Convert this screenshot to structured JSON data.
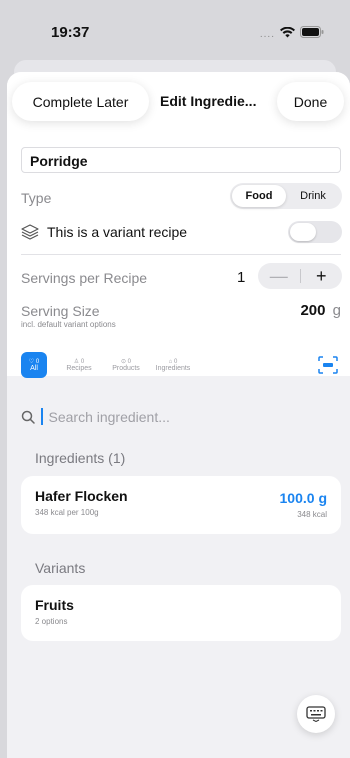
{
  "status_bar": {
    "time": "19:37",
    "dots": "...."
  },
  "nav": {
    "left_button": "Complete Later",
    "title": "Edit Ingredie...",
    "right_button": "Done"
  },
  "recipe": {
    "name": "Porridge"
  },
  "type": {
    "label": "Type",
    "options": [
      "Food",
      "Drink"
    ],
    "selected": "Food"
  },
  "variant": {
    "label": "This is a variant recipe",
    "enabled": false
  },
  "servings": {
    "label": "Servings per Recipe",
    "value": "1",
    "minus": "—",
    "plus": "+"
  },
  "serving_size": {
    "label": "Serving Size",
    "sub": "incl. default variant options",
    "value": "200",
    "unit": "g"
  },
  "filters": [
    {
      "count": "0",
      "label": "All",
      "active": true
    },
    {
      "count": "0",
      "label": "Recipes"
    },
    {
      "count": "0",
      "label": "Products"
    },
    {
      "count": "0",
      "label": "Ingredients"
    }
  ],
  "search": {
    "placeholder": "Search ingredient..."
  },
  "ingredients": {
    "title": "Ingredients (1)",
    "items": [
      {
        "name": "Hafer Flocken",
        "sub": "348 kcal per 100g",
        "amount": "100.0 g",
        "kcal": "348 kcal"
      }
    ]
  },
  "variants": {
    "title": "Variants",
    "items": [
      {
        "name": "Fruits",
        "sub": "2 options"
      }
    ]
  },
  "colors": {
    "accent": "#1a84f0",
    "background": "#f1f1f4"
  }
}
